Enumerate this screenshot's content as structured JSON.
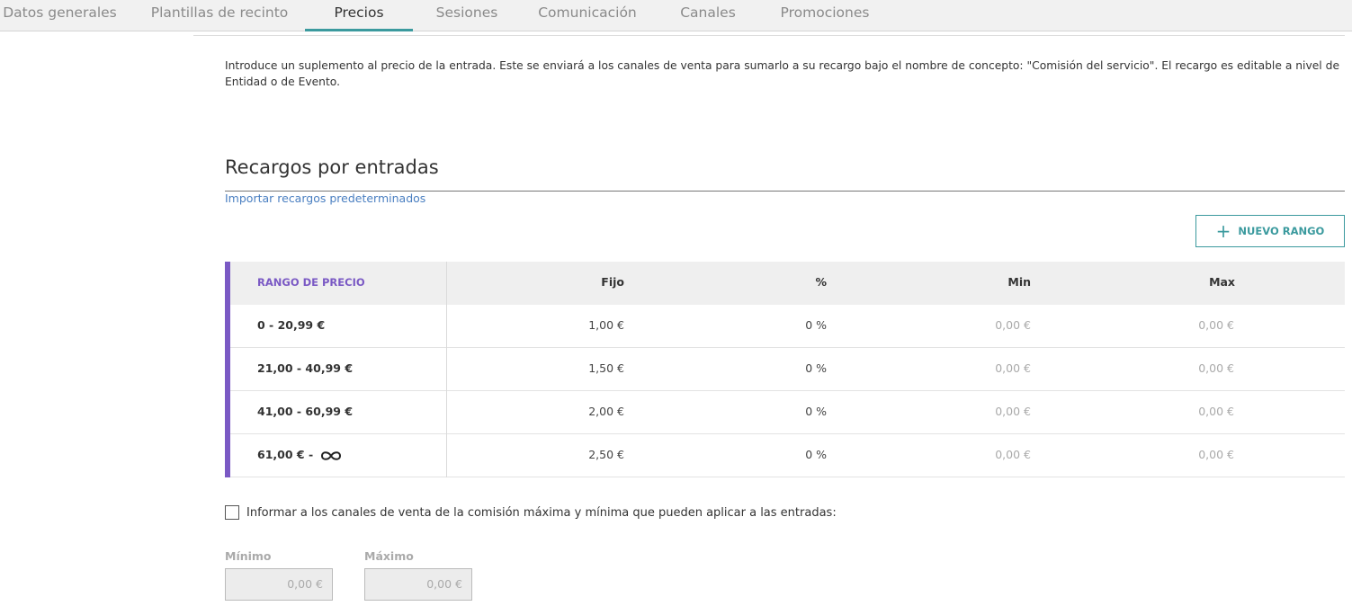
{
  "tabs": [
    "Datos generales",
    "Plantillas de recinto",
    "Precios",
    "Sesiones",
    "Comunicación",
    "Canales",
    "Promociones"
  ],
  "active_tab": "Precios",
  "accent_color": "#3b9a9e",
  "range_accent_color": "#7a59c4",
  "intro_text": "Introduce un suplemento al precio de la entrada. Este se enviará a los canales de venta para sumarlo a su recargo bajo el nombre de concepto: \"Comisión del servicio\". El recargo es editable a nivel de Entidad o de Evento.",
  "section": {
    "title": "Recargos por entradas",
    "import_link": "Importar recargos predeterminados",
    "new_range_button": "NUEVO RANGO",
    "new_range_icon": "plus-icon"
  },
  "table": {
    "headers": {
      "range": "RANGO DE PRECIO",
      "fixed": "Fijo",
      "percent": "%",
      "min": "Min",
      "max": "Max"
    },
    "rows": [
      {
        "range": "0 - 20,99 €",
        "fixed": "1,00 €",
        "percent": "0 %",
        "min": "0,00 €",
        "max": "0,00 €"
      },
      {
        "range": "21,00 - 40,99 €",
        "fixed": "1,50 €",
        "percent": "0 %",
        "min": "0,00 €",
        "max": "0,00 €"
      },
      {
        "range": "41,00 - 60,99 €",
        "fixed": "2,00 €",
        "percent": "0 %",
        "min": "0,00 €",
        "max": "0,00 €"
      },
      {
        "range": "61,00 € - ",
        "range_icon": "infinity-icon",
        "fixed": "2,50 €",
        "percent": "0 %",
        "min": "0,00 €",
        "max": "0,00 €"
      }
    ]
  },
  "commission_info": {
    "checkbox_label": "Informar a los canales de venta de la comisión máxima y mínima que pueden aplicar a las entradas:",
    "checked": false,
    "min_label": "Mínimo",
    "min_value": "0,00 €",
    "max_label": "Máximo",
    "max_value": "0,00 €"
  }
}
